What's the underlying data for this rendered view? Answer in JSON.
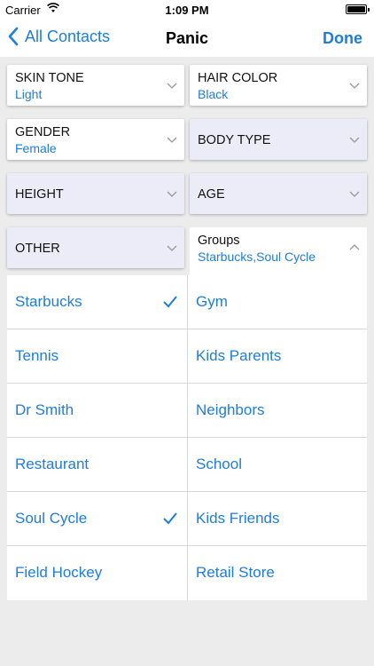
{
  "status": {
    "carrier": "Carrier",
    "time": "1:09 PM"
  },
  "nav": {
    "back": "All Contacts",
    "title": "Panic",
    "done": "Done"
  },
  "filters": {
    "skin_tone": {
      "label": "SKIN TONE",
      "value": "Light"
    },
    "hair_color": {
      "label": "HAIR COLOR",
      "value": "Black"
    },
    "gender": {
      "label": "GENDER",
      "value": "Female"
    },
    "body_type": {
      "label": "BODY TYPE"
    },
    "height": {
      "label": "HEIGHT"
    },
    "age": {
      "label": "AGE"
    },
    "other": {
      "label": "OTHER"
    },
    "groups": {
      "label": "Groups",
      "value": "Starbucks,Soul Cycle"
    }
  },
  "groups": [
    {
      "left": {
        "name": "Starbucks",
        "checked": true
      },
      "right": {
        "name": "Gym",
        "checked": false
      }
    },
    {
      "left": {
        "name": "Tennis",
        "checked": false
      },
      "right": {
        "name": "Kids Parents",
        "checked": false
      }
    },
    {
      "left": {
        "name": "Dr Smith",
        "checked": false
      },
      "right": {
        "name": "Neighbors",
        "checked": false
      }
    },
    {
      "left": {
        "name": "Restaurant",
        "checked": false
      },
      "right": {
        "name": "School",
        "checked": false
      }
    },
    {
      "left": {
        "name": "Soul Cycle",
        "checked": true
      },
      "right": {
        "name": "Kids Friends",
        "checked": false
      }
    },
    {
      "left": {
        "name": "Field Hockey",
        "checked": false
      },
      "right": {
        "name": "Retail Store",
        "checked": false
      }
    }
  ],
  "colors": {
    "accent": "#1d7de0",
    "card_lavender": "#ececf8",
    "background": "#ececec"
  }
}
